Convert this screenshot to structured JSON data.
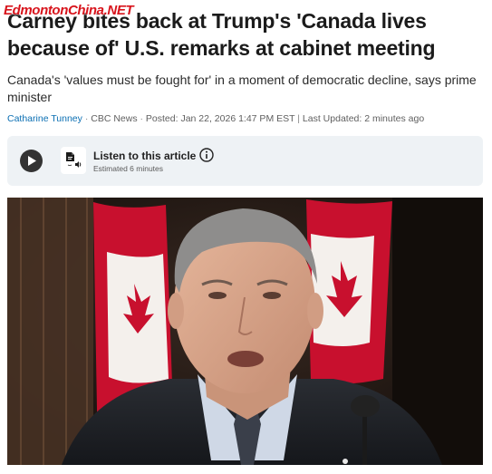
{
  "watermark": "EdmontonChina.NET",
  "article": {
    "headline": "Carney bites back at Trump's 'Canada lives because of' U.S. remarks at cabinet meeting",
    "deck": "Canada's 'values must be fought for' in a moment of democratic decline, says prime minister",
    "byline": {
      "author": "Catharine Tunney",
      "source": "CBC News",
      "posted": "Posted: Jan 22, 2026 1:47 PM EST",
      "updated": "Last Updated: 2 minutes ago"
    }
  },
  "audio": {
    "title": "Listen to this article",
    "estimate": "Estimated 6 minutes",
    "play_icon": "play-icon",
    "audio_icon": "audio-document-icon",
    "info_icon": "info-icon"
  },
  "colors": {
    "link": "#0b6fb3",
    "flag_red": "#c8102e",
    "box_bg": "#eef2f5"
  }
}
